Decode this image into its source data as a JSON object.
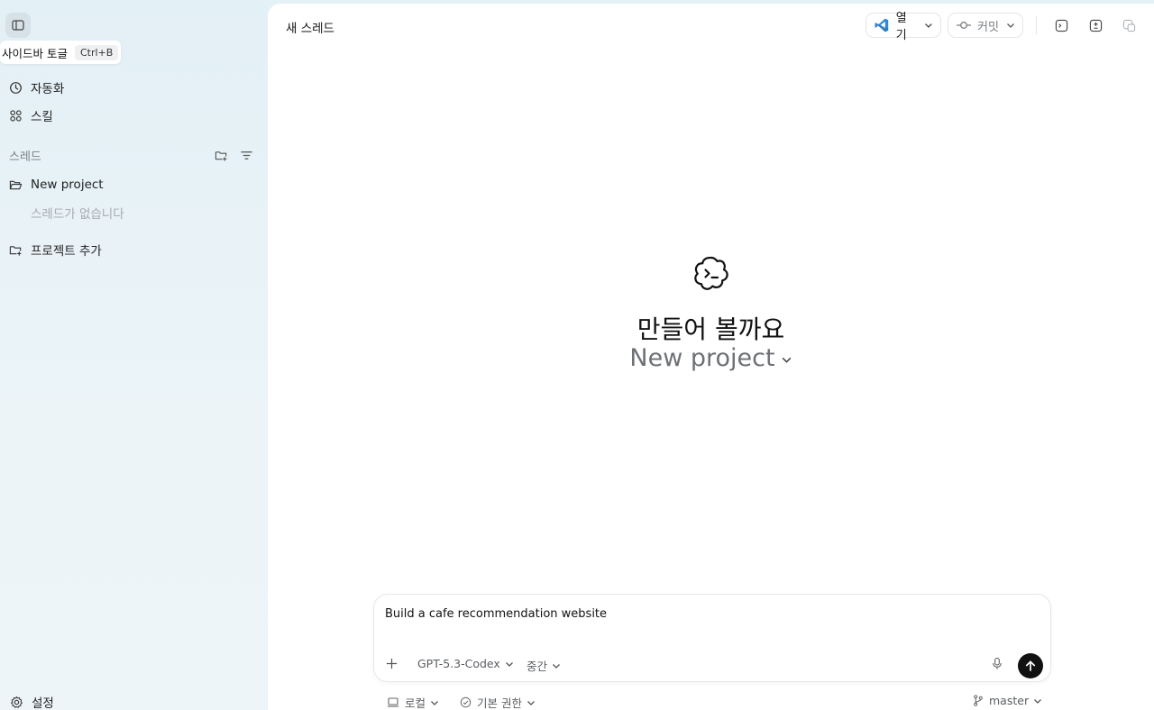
{
  "sidebar": {
    "tooltip": {
      "label": "사이드바 토글",
      "shortcut": "Ctrl+B"
    },
    "nav": [
      {
        "label": "자동화",
        "icon": "clock-icon"
      },
      {
        "label": "스킬",
        "icon": "grid-icon"
      }
    ],
    "threads_label": "스레드",
    "project": {
      "name": "New project",
      "empty_text": "스레드가 없습니다"
    },
    "add_project_label": "프로젝트 추가",
    "settings_label": "설정"
  },
  "header": {
    "title": "새 스레드",
    "open_label": "열기",
    "commit_label": "커밋"
  },
  "hero": {
    "title": "만들어 볼까요",
    "project": "New project"
  },
  "composer": {
    "text": "Build a cafe recommendation website",
    "model": "GPT-5.3-Codex",
    "effort": "중간"
  },
  "footer": {
    "environment": "로컬",
    "permissions": "기본 권한",
    "branch": "master"
  },
  "colors": {
    "sidebar_bg": "#e3f0f6",
    "main_bg": "#ffffff",
    "vscode_blue": "#2c8ad8",
    "send_button": "#111111"
  }
}
